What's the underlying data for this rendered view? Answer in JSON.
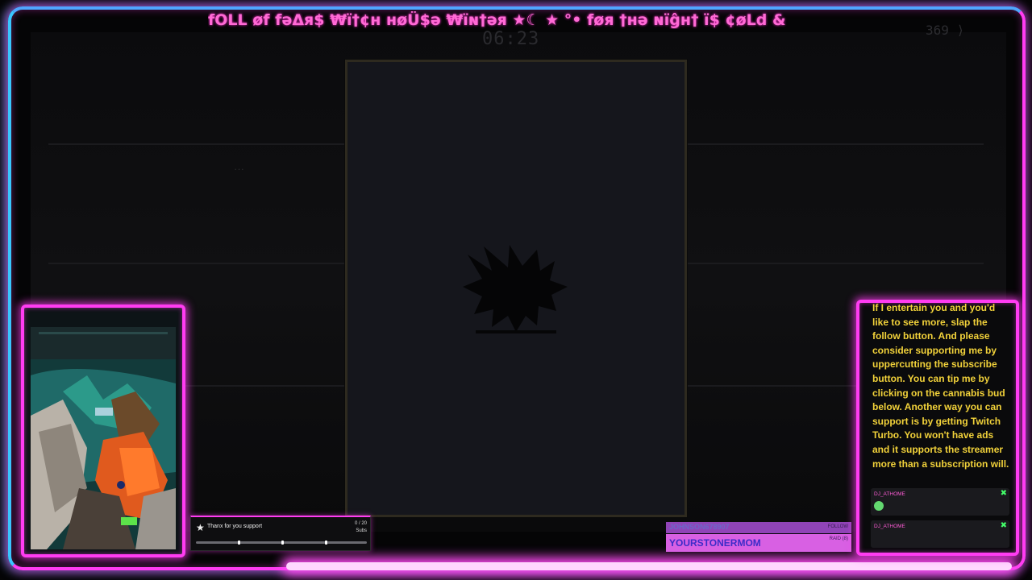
{
  "marquee_text": "fOLL øf fəΔя$ ₩ï†¢н нøÜ$ə ₩ïɴ†əя ★☾  ★ °• føя †нə ɴïĝн† ï$ ¢øLd &",
  "game": {
    "timer": "06:23",
    "counter": "369 ⟩",
    "bg_text": "···"
  },
  "goal": {
    "icon": "star-icon",
    "label": "Thanx for you support",
    "count": "0 / 20",
    "unit": "Subs",
    "progress": 0.0
  },
  "events": {
    "follow_name": "JOHNSON678907",
    "follow_tag": "FOLLOW",
    "raid_name": "YOURSTONERMOM",
    "raid_tag": "RAID (8)"
  },
  "chat": {
    "message": "If I entertain you and you'd like to see more, slap the follow button. And please consider supporting me by uppercutting the subscribe button. You can tip me by clicking on the cannabis bud below. Another way you can support is by getting Twitch Turbo. You won't have ads and it supports the streamer more than a subscription will.",
    "entries": [
      {
        "user": "DJ_ATHOME",
        "badge_color": "#44ff6a"
      },
      {
        "user": "DJ_ATHOME",
        "badge_color": "#44ff6a"
      }
    ]
  },
  "colors": {
    "neon_pink": "#ff3cf2",
    "neon_blue": "#39c6ff",
    "chat_text": "#f2d23a"
  }
}
